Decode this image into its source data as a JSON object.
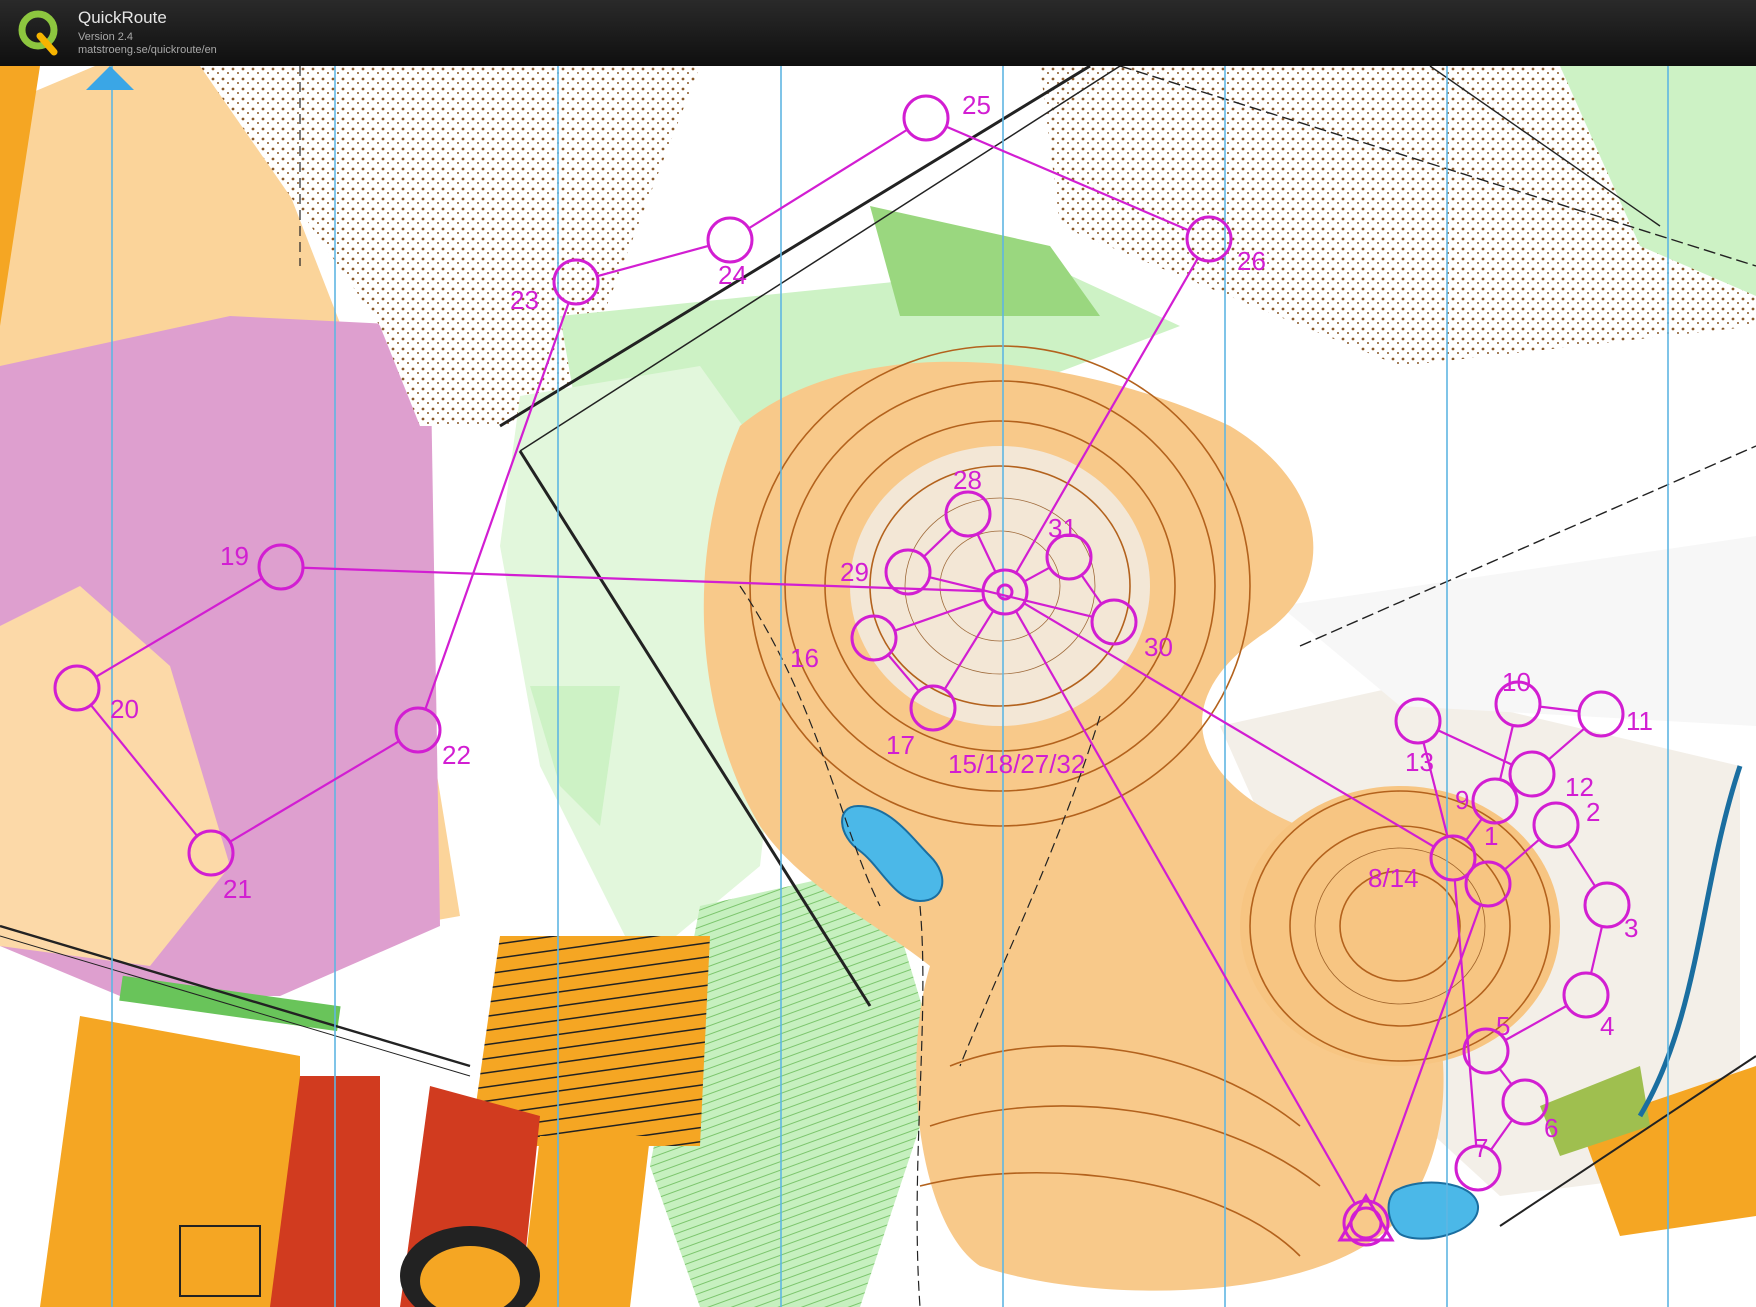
{
  "app": {
    "title": "QuickRoute",
    "version": "Version 2.4",
    "url": "matstroeng.se/quickroute/en",
    "logo_icon": "quickroute-q-logo-icon"
  },
  "map": {
    "type": "orienteering-map",
    "course_color": "#d21ed2",
    "north_arrow_icon": "north-arrow-icon",
    "controls": [
      {
        "label": "15/18/27/32"
      },
      {
        "label": "1"
      },
      {
        "label": "2"
      },
      {
        "label": "3"
      },
      {
        "label": "4"
      },
      {
        "label": "5"
      },
      {
        "label": "6"
      },
      {
        "label": "7"
      },
      {
        "label": "8/14"
      },
      {
        "label": "9"
      },
      {
        "label": "10"
      },
      {
        "label": "11"
      },
      {
        "label": "12"
      },
      {
        "label": "13"
      },
      {
        "label": "16"
      },
      {
        "label": "17"
      },
      {
        "label": "19"
      },
      {
        "label": "20"
      },
      {
        "label": "21"
      },
      {
        "label": "22"
      },
      {
        "label": "23"
      },
      {
        "label": "24"
      },
      {
        "label": "25"
      },
      {
        "label": "26"
      },
      {
        "label": "28"
      },
      {
        "label": "29"
      },
      {
        "label": "30"
      },
      {
        "label": "31"
      }
    ]
  }
}
